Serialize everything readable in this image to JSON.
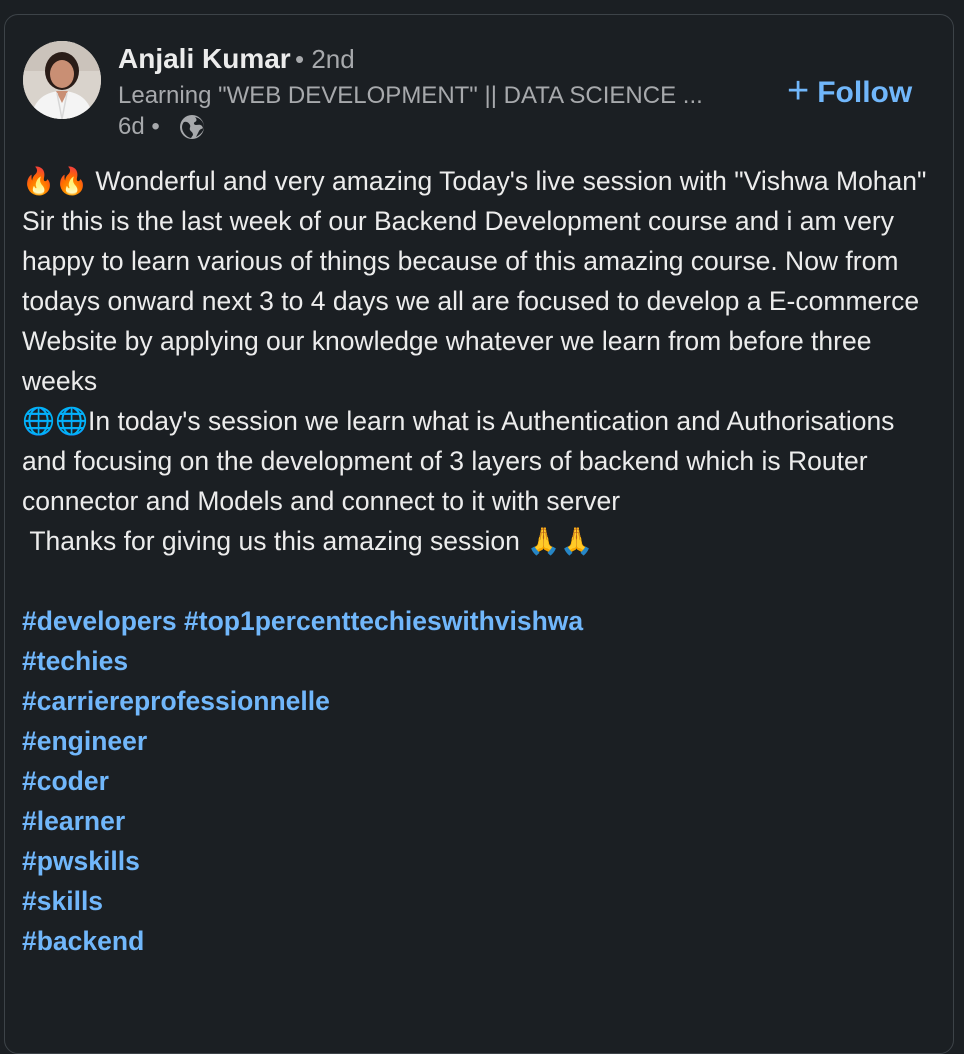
{
  "post": {
    "author": {
      "name": "Anjali Kumar",
      "degree": "• 2nd",
      "headline": "Learning \"WEB DEVELOPMENT\" || DATA SCIENCE ...",
      "time": "6d •",
      "visibility_icon": "globe-icon"
    },
    "follow_button": {
      "icon": "plus-icon",
      "label": "Follow"
    },
    "body": {
      "paragraph1": "🔥🔥 Wonderful and very amazing Today's live session with \"Vishwa Mohan\" Sir this is the last week of our Backend Development course and i am very happy to learn various of things because of this amazing course. Now from todays onward next 3 to 4 days we all are focused to develop a E-commerce Website by applying our knowledge whatever we learn from before three weeks",
      "paragraph2": "🌐🌐In today's session we learn what is Authentication and Authorisations and focusing on the development of 3 layers of backend which is Router connector and Models and connect to it with server",
      "paragraph3": " Thanks for giving us this amazing session 🙏🙏"
    },
    "hashtags": [
      "#developers",
      "#top1percenttechieswithvishwa",
      "#techies",
      "#carriereprofessionnelle",
      "#engineer",
      "#coder",
      "#learner",
      "#pwskills",
      "#skills",
      "#backend"
    ],
    "colors": {
      "background": "#1b1f23",
      "text": "#ececec",
      "muted": "#a7a9ac",
      "link": "#71b7fb",
      "border": "#3d4348"
    }
  }
}
